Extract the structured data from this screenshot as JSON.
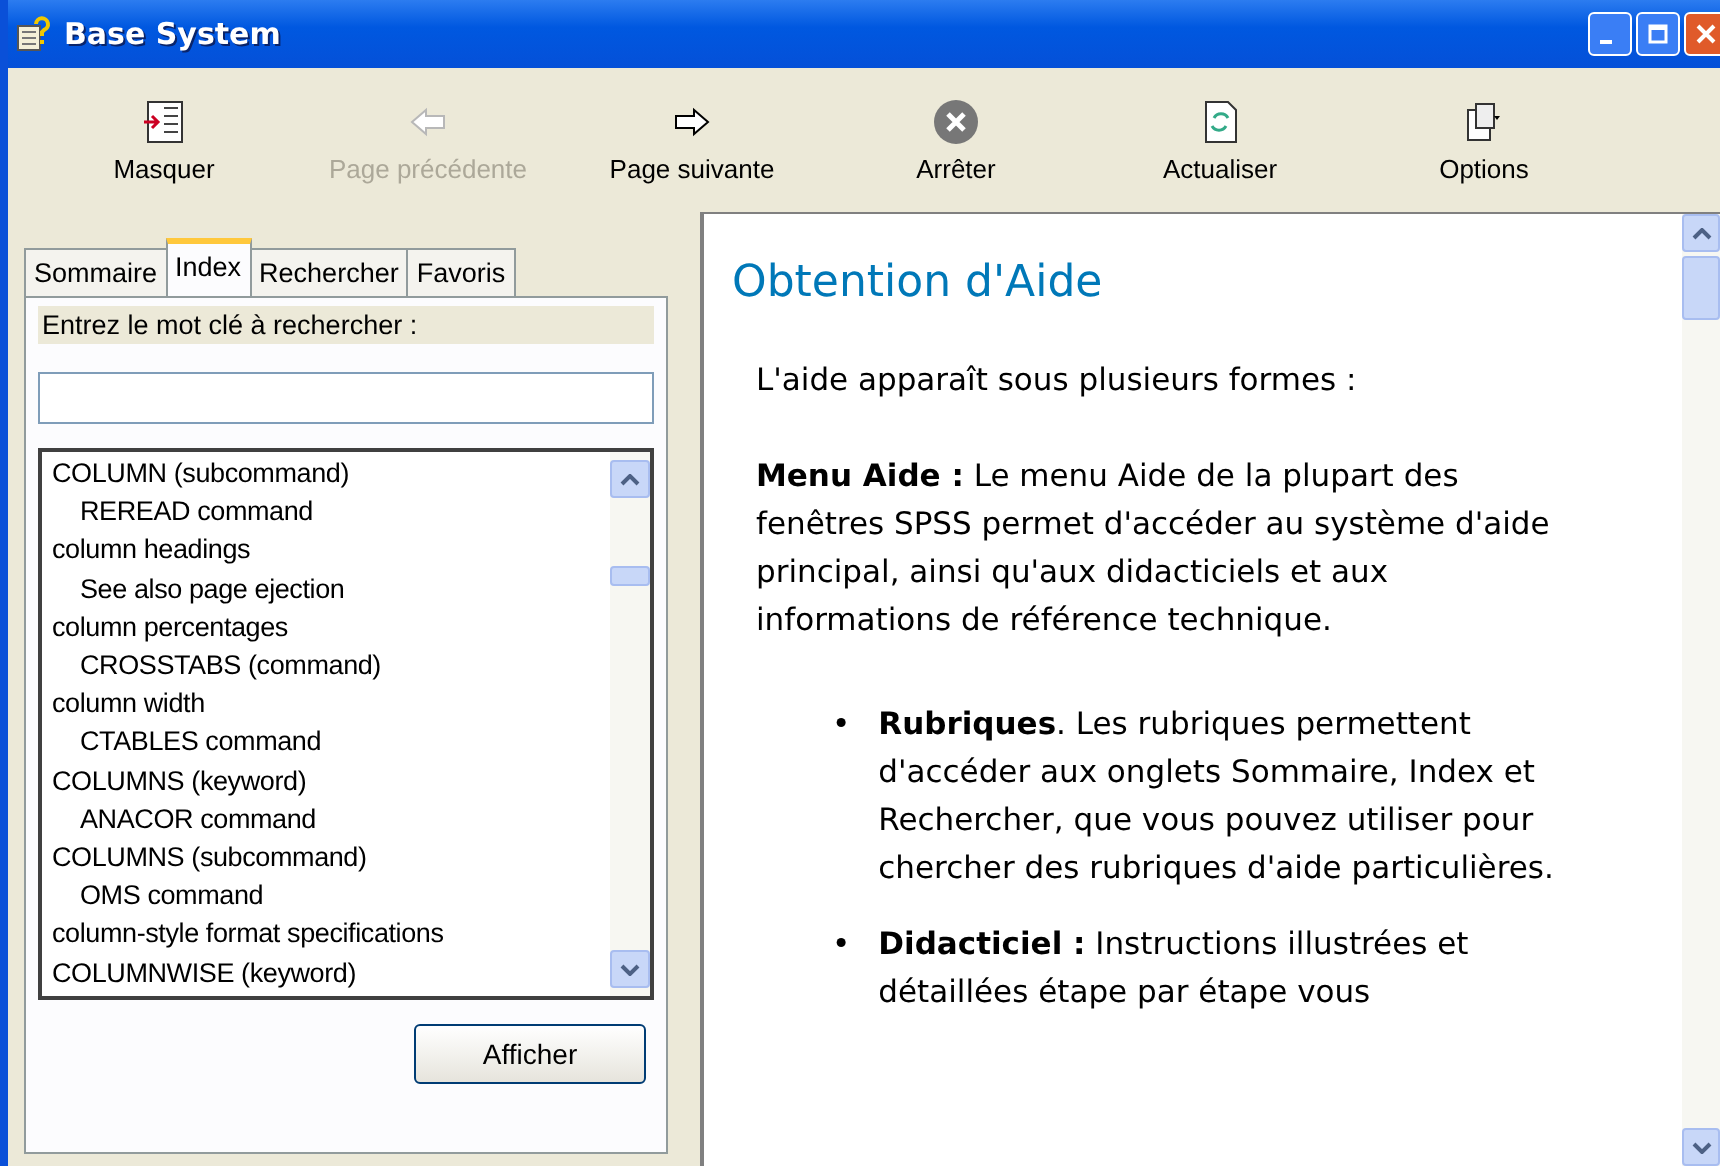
{
  "window": {
    "title": "Base System"
  },
  "toolbar": [
    {
      "label": "Masquer",
      "disabled": false
    },
    {
      "label": "Page précédente",
      "disabled": true
    },
    {
      "label": "Page suivante",
      "disabled": false
    },
    {
      "label": "Arrêter",
      "disabled": false
    },
    {
      "label": "Actualiser",
      "disabled": false
    },
    {
      "label": "Options",
      "disabled": false
    }
  ],
  "tabs": [
    {
      "label": "Sommaire",
      "selected": false
    },
    {
      "label": "Index",
      "selected": true
    },
    {
      "label": "Rechercher",
      "selected": false
    },
    {
      "label": "Favoris",
      "selected": false
    }
  ],
  "keyword_label": "Entrez le mot clé à rechercher :",
  "index_items": [
    {
      "label": "COLUMN (subcommand)",
      "children": [
        {
          "label": "REREAD command"
        }
      ]
    },
    {
      "label": "column headings",
      "children": [
        {
          "label": "See also page ejection"
        }
      ]
    },
    {
      "label": "column percentages",
      "children": [
        {
          "label": "CROSSTABS (command)"
        }
      ]
    },
    {
      "label": "column width",
      "children": [
        {
          "label": "CTABLES command"
        }
      ]
    },
    {
      "label": "COLUMNS (keyword)",
      "children": [
        {
          "label": "ANACOR command"
        }
      ]
    },
    {
      "label": "COLUMNS (subcommand)",
      "children": [
        {
          "label": "OMS command"
        }
      ]
    },
    {
      "label": "column-style format specifications"
    },
    {
      "label": "COLUMNWISE (keyword)"
    }
  ],
  "display_button": "Afficher",
  "content": {
    "heading": "Obtention d'Aide",
    "intro": "L'aide apparaît sous plusieurs formes :",
    "paragraph": "**Menu Aide :** Le menu Aide de la plupart des fenêtres SPSS permet d'accéder au système d'aide principal, ainsi qu'aux didacticiels et aux informations de référence technique.",
    "bullets": [
      {
        "marker": "•",
        "text": "**Rubriques**. Les rubriques permettent d'accéder aux onglets Sommaire, Index et Rechercher, que vous pouvez utiliser pour chercher des rubriques d'aide particulières."
      },
      {
        "marker": "•",
        "text": "**Didacticiel :** Instructions illustrées et détaillées étape par étape vous"
      }
    ]
  }
}
